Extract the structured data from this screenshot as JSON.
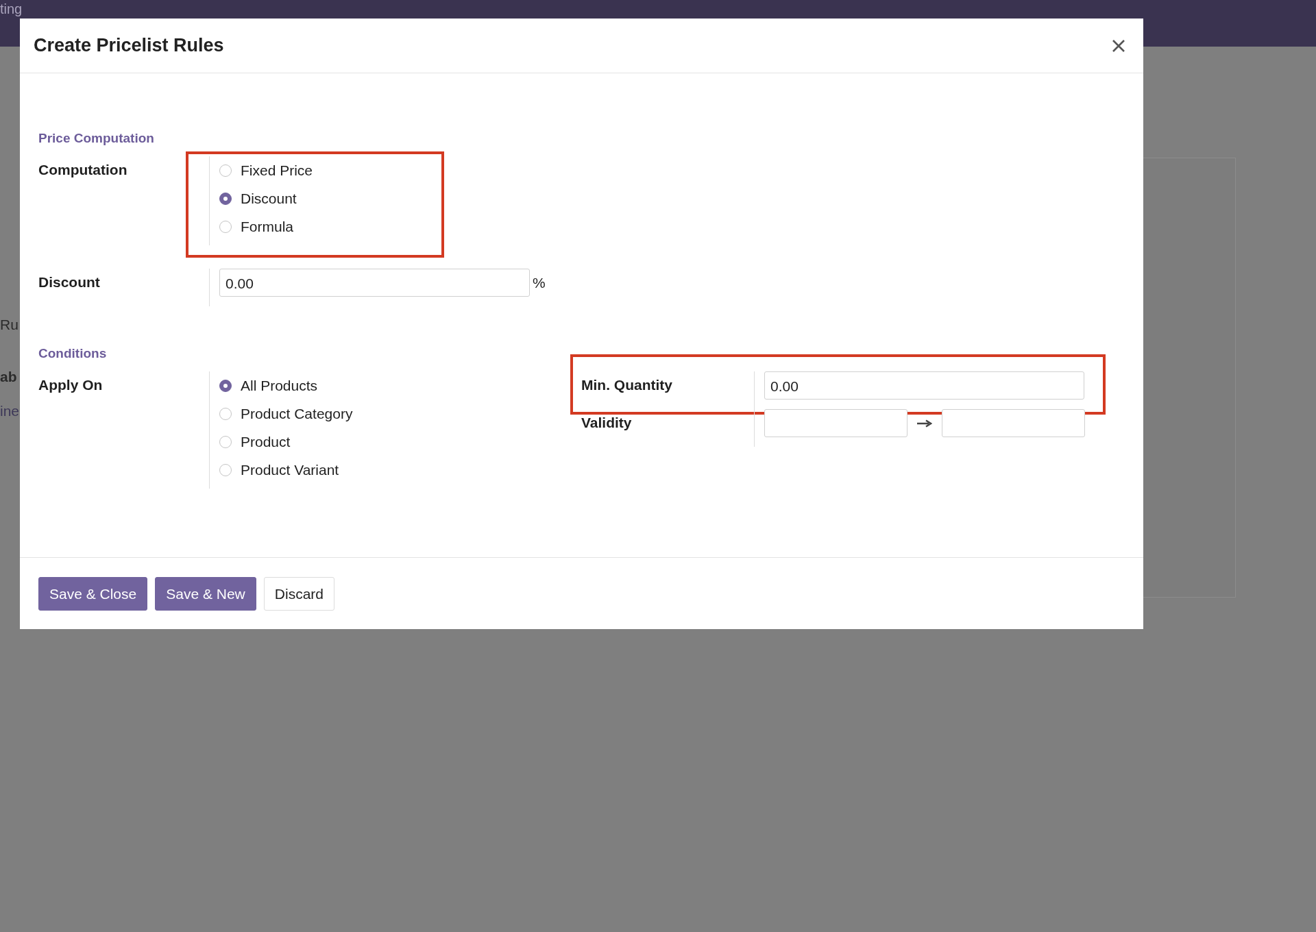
{
  "background": {
    "menu_items": [
      "ting"
    ],
    "fragments": [
      {
        "text": "Ru",
        "kind": "plain"
      },
      {
        "text": "ab",
        "kind": "bold"
      },
      {
        "text": "ine",
        "kind": "link"
      }
    ]
  },
  "dialog": {
    "title": "Create Pricelist Rules",
    "sections": [
      {
        "title": "Price Computation",
        "columns": [
          [
            {
              "label": "Computation",
              "kind": "radio",
              "highlighted": true,
              "options": [
                {
                  "label": "Fixed Price",
                  "selected": false
                },
                {
                  "label": "Discount",
                  "selected": true
                },
                {
                  "label": "Formula",
                  "selected": false
                }
              ]
            },
            {
              "label": "Discount",
              "kind": "number",
              "value": "0.00",
              "suffix": "%",
              "highlighted": false
            }
          ]
        ]
      },
      {
        "title": "Conditions",
        "columns": [
          [
            {
              "label": "Apply On",
              "kind": "radio",
              "highlighted": false,
              "options": [
                {
                  "label": "All Products",
                  "selected": true
                },
                {
                  "label": "Product Category",
                  "selected": false
                },
                {
                  "label": "Product",
                  "selected": false
                },
                {
                  "label": "Product Variant",
                  "selected": false
                }
              ]
            }
          ],
          [
            {
              "label": "Min. Quantity",
              "kind": "number",
              "value": "0.00",
              "highlighted": true
            },
            {
              "label": "Validity",
              "kind": "daterange",
              "highlighted": false
            }
          ]
        ]
      }
    ],
    "buttons": [
      {
        "label": "Save & Close",
        "kind": "primary"
      },
      {
        "label": "Save & New",
        "kind": "primary"
      },
      {
        "label": "Discard",
        "kind": "secondary"
      }
    ]
  }
}
